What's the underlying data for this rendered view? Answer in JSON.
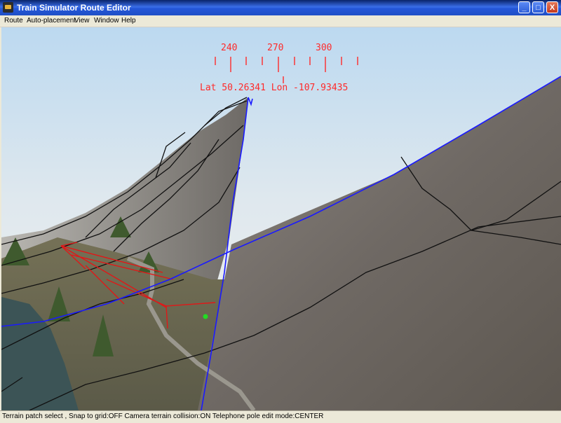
{
  "window": {
    "title": "Train Simulator Route Editor",
    "icon": "app-icon",
    "buttons": {
      "minimize": "_",
      "maximize": "□",
      "close": "X"
    }
  },
  "menu": {
    "items": [
      "Route",
      "Auto-placement",
      "View",
      "Window",
      "Help"
    ]
  },
  "hud": {
    "compass_labels": [
      "240",
      "270",
      "300"
    ],
    "coordinates": "Lat 50.26341 Lon -107.93435"
  },
  "status": {
    "text": "Terrain patch select , Snap to grid:OFF Camera terrain collision:ON Telephone pole edit mode:CENTER"
  },
  "colors": {
    "hud": "#ff2a2a",
    "boundary_line": "#1a1aff",
    "terrain_line": "#000000"
  }
}
